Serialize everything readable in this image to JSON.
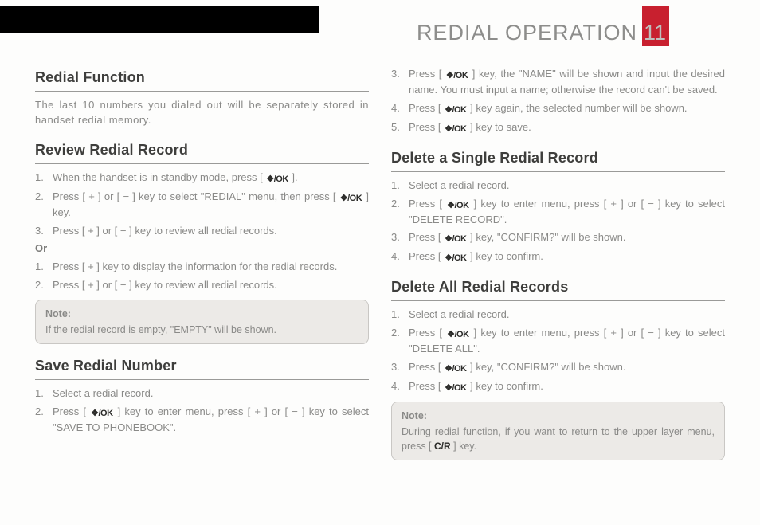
{
  "icons": {
    "menu_ok": "❖/OK",
    "cr": "C/R"
  },
  "header": {
    "title": "REDIAL OPERATION",
    "page_number": "11"
  },
  "s1": {
    "title": "Redial Function",
    "body": "The last 10 numbers you dialed out will be separately stored in handset redial memory."
  },
  "s2": {
    "title": "Review Redial Record",
    "list1_1a": "When the handset is in standby mode, press [ ",
    "list1_1b": " ].",
    "list1_2a": "Press [ + ] or [ − ] key to select \"REDIAL\" menu, then press [ ",
    "list1_2b": " ] key.",
    "list1_3": "Press [ + ] or [ − ] key to review all redial records.",
    "or": "Or",
    "list2_1": "Press [ + ] key to display the information for the redial records.",
    "list2_2": "Press [ + ] or [ − ] key to review all redial records.",
    "note_label": "Note:",
    "note_body": "If the redial record is empty, \"EMPTY\" will be shown."
  },
  "s3": {
    "title": "Save Redial Number",
    "i1": "Select a redial record.",
    "i2a": "Press [ ",
    "i2b": " ] key to enter menu, press [ + ] or [ − ] key to select \"SAVE TO PHONEBOOK\".",
    "i3a": "Press [ ",
    "i3b": " ] key, the \"NAME\" will be shown and input the desired name. You must input a name; otherwise the record can't be saved.",
    "i4a": "Press [ ",
    "i4b": " ] key again, the selected number will be shown.",
    "i5a": "Press [ ",
    "i5b": " ] key to save."
  },
  "s4": {
    "title": "Delete a Single Redial Record",
    "i1": "Select a redial record.",
    "i2a": "Press [ ",
    "i2b": " ] key to enter menu, press [ + ] or [ − ] key to select \"DELETE RECORD\".",
    "i3a": "Press [ ",
    "i3b": " ] key, \"CONFIRM?\" will be shown.",
    "i4a": "Press [ ",
    "i4b": " ] key to confirm."
  },
  "s5": {
    "title": "Delete All Redial Records",
    "i1": "Select a redial record.",
    "i2a": "Press [ ",
    "i2b": " ] key to enter menu, press [ + ] or [ − ] key to select \"DELETE ALL\".",
    "i3a": "Press [ ",
    "i3b": " ] key, \"CONFIRM?\" will be shown.",
    "i4a": "Press [ ",
    "i4b": " ] key to confirm.",
    "note_label": "Note:",
    "note_a": "During redial function, if you want to return to the upper layer menu, press [ ",
    "note_b": " ] key."
  }
}
